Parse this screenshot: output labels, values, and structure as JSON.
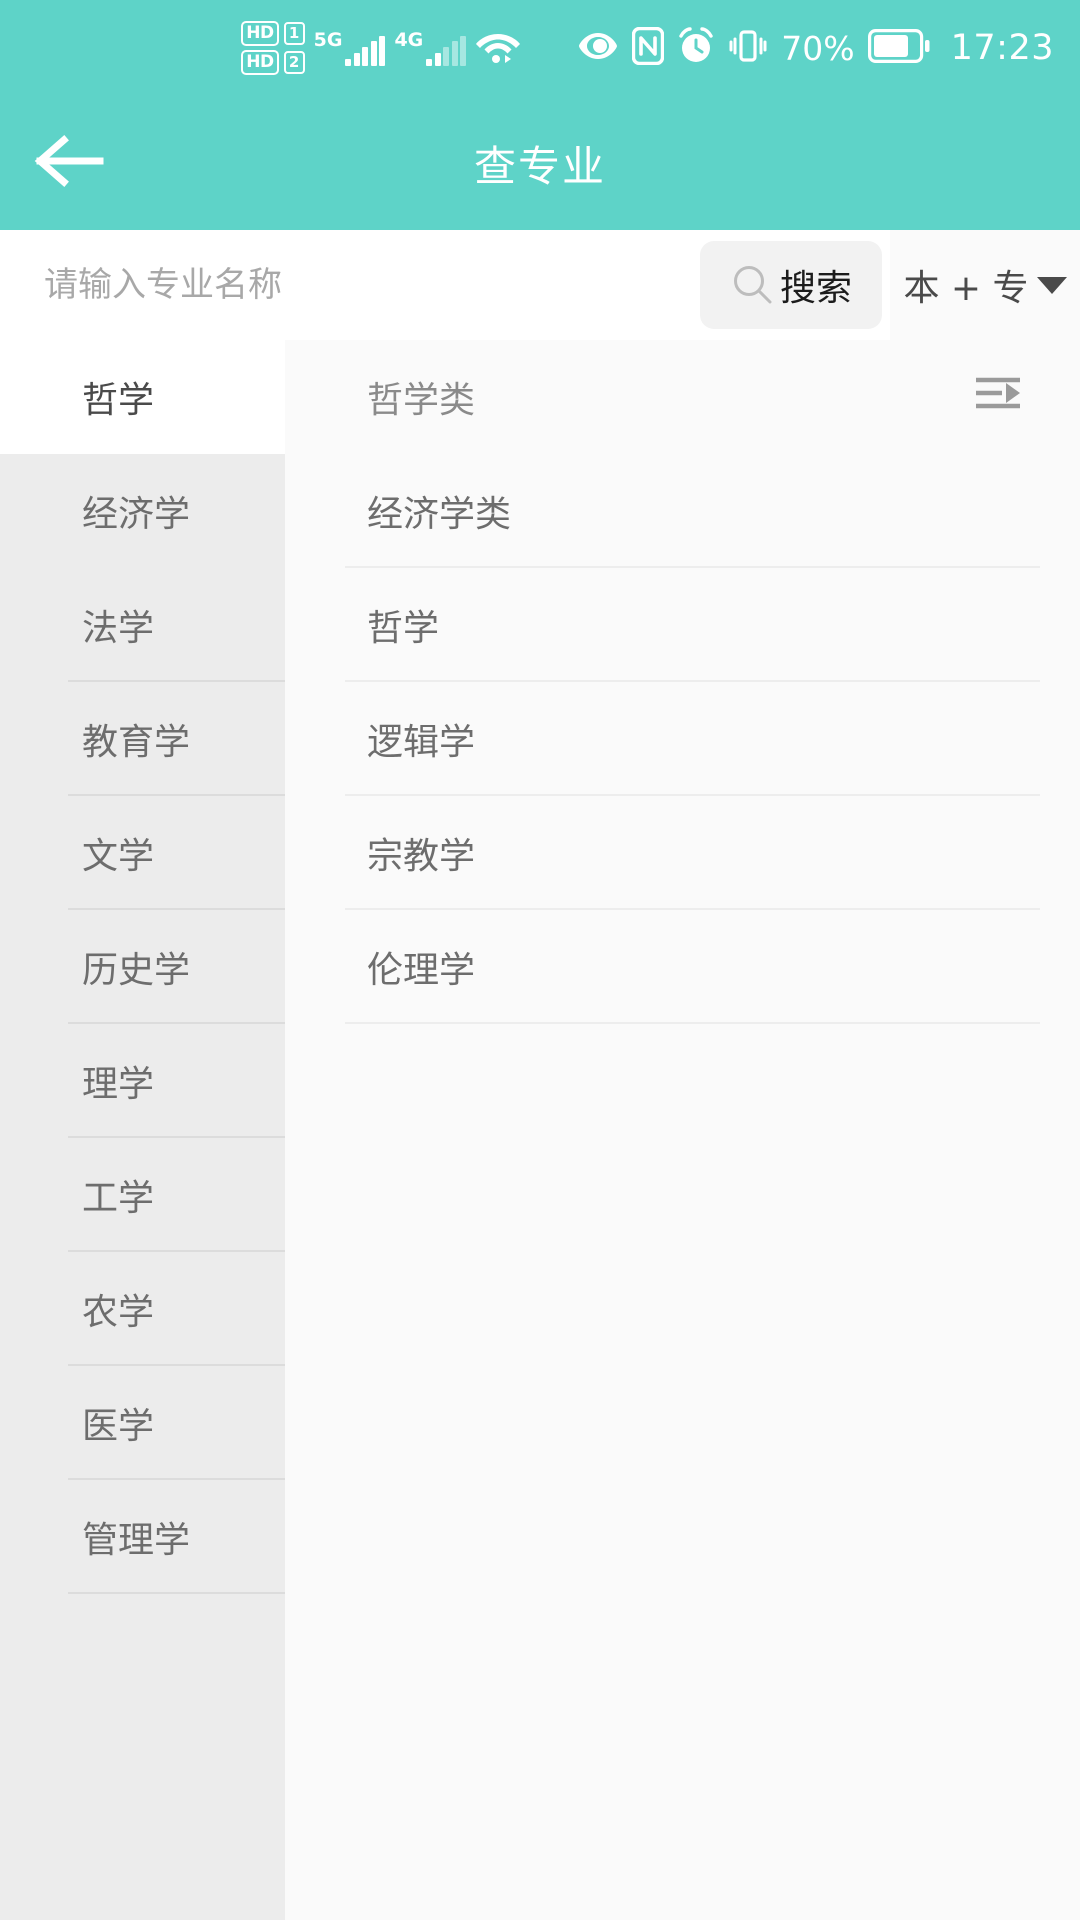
{
  "statusbar": {
    "hd1_label": "HD",
    "hd1_sim": "1",
    "hd2_label": "HD",
    "hd2_sim": "2",
    "net1_label": "5G",
    "net2_label": "4G",
    "wifi_icon": "wifi-icon",
    "eye_icon": "eye-protection-icon",
    "nfc_icon": "nfc-icon",
    "alarm_icon": "alarm-clock-icon",
    "vibrate_icon": "vibrate-icon",
    "battery_percent": "70%",
    "battery_icon": "battery-icon",
    "time": "17:23"
  },
  "titlebar": {
    "back_icon": "back-arrow-icon",
    "title": "查专业"
  },
  "search": {
    "placeholder": "请输入专业名称",
    "value": "",
    "search_icon": "search-icon",
    "search_label": "搜索",
    "filter_label": "本 + 专",
    "filter_caret_icon": "chevron-down-icon"
  },
  "sidebar": {
    "items": [
      {
        "label": "哲学",
        "active": true
      },
      {
        "label": "经济学",
        "active": false
      },
      {
        "label": "法学",
        "active": false
      },
      {
        "label": "教育学",
        "active": false
      },
      {
        "label": "文学",
        "active": false
      },
      {
        "label": "历史学",
        "active": false
      },
      {
        "label": "理学",
        "active": false
      },
      {
        "label": "工学",
        "active": false
      },
      {
        "label": "农学",
        "active": false
      },
      {
        "label": "医学",
        "active": false
      },
      {
        "label": "管理学",
        "active": false
      }
    ]
  },
  "main": {
    "header_label": "哲学类",
    "header_icon": "list-indent-icon",
    "items": [
      {
        "label": "经济学类"
      },
      {
        "label": "哲学"
      },
      {
        "label": "逻辑学"
      },
      {
        "label": "宗教学"
      },
      {
        "label": "伦理学"
      }
    ]
  },
  "colors": {
    "brand_teal": "#5ed3c8",
    "sidebar_bg": "#ececec",
    "panel_bg": "#fafafa",
    "text_gray": "#6d6d6d"
  }
}
